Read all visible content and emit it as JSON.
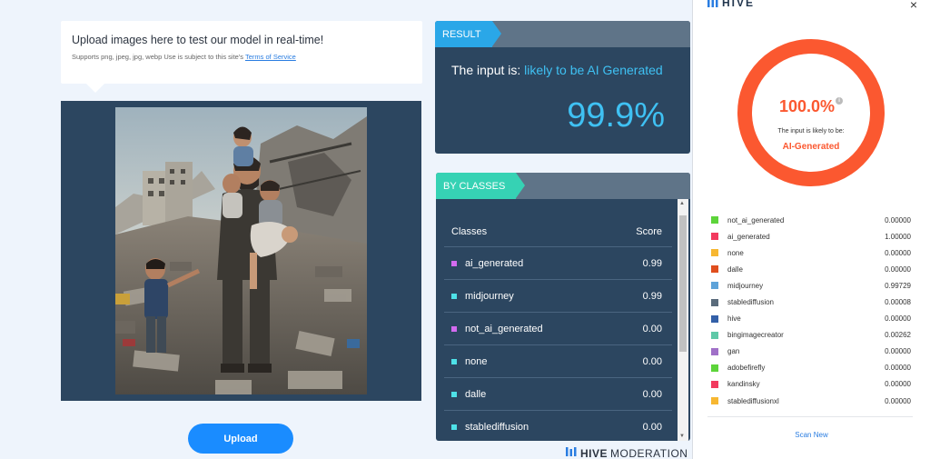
{
  "upload": {
    "title": "Upload images here to test our model in real-time!",
    "subtitle_prefix": "Supports png, jpeg, jpg, webp Use is subject to this site's ",
    "terms_link": "Terms of Service",
    "button_label": "Upload"
  },
  "result": {
    "tag": "RESULT",
    "line_prefix": "The input is: ",
    "verdict": "likely to be AI Generated",
    "percent": "99.9%"
  },
  "classes": {
    "tag": "BY CLASSES",
    "header_classes": "Classes",
    "header_score": "Score",
    "rows": [
      {
        "name": "ai_generated",
        "score": "0.99",
        "color": "#d36bf0"
      },
      {
        "name": "midjourney",
        "score": "0.99",
        "color": "#4ee1e8"
      },
      {
        "name": "not_ai_generated",
        "score": "0.00",
        "color": "#d36bf0"
      },
      {
        "name": "none",
        "score": "0.00",
        "color": "#4ee1e8"
      },
      {
        "name": "dalle",
        "score": "0.00",
        "color": "#4ee1e8"
      },
      {
        "name": "stablediffusion",
        "score": "0.00",
        "color": "#4ee1e8"
      }
    ]
  },
  "footer_brand": {
    "strong": "HIVE",
    "rest": "MODERATION"
  },
  "side_panel": {
    "logo": "HIVE",
    "close": "×",
    "ring_percent": "100.0%",
    "ring_info": "i",
    "ring_sub": "The input is likely to be:",
    "ring_label": "AI-Generated",
    "ring_color": "#fb5830",
    "rows": [
      {
        "name": "not_ai_generated",
        "score": "0.00000",
        "color": "#5dd43a"
      },
      {
        "name": "ai_generated",
        "score": "1.00000",
        "color": "#f23a5e"
      },
      {
        "name": "none",
        "score": "0.00000",
        "color": "#f7b731"
      },
      {
        "name": "dalle",
        "score": "0.00000",
        "color": "#e04e1e"
      },
      {
        "name": "midjourney",
        "score": "0.99729",
        "color": "#5ea3d9"
      },
      {
        "name": "stablediffusion",
        "score": "0.00008",
        "color": "#5a6b7b"
      },
      {
        "name": "hive",
        "score": "0.00000",
        "color": "#3360a8"
      },
      {
        "name": "bingimagecreator",
        "score": "0.00262",
        "color": "#5fc9a8"
      },
      {
        "name": "gan",
        "score": "0.00000",
        "color": "#a070c8"
      },
      {
        "name": "adobefirefly",
        "score": "0.00000",
        "color": "#5dd43a"
      },
      {
        "name": "kandinsky",
        "score": "0.00000",
        "color": "#f23a5e"
      },
      {
        "name": "stablediffusionxl",
        "score": "0.00000",
        "color": "#f7b731"
      }
    ],
    "scan_new": "Scan New"
  }
}
